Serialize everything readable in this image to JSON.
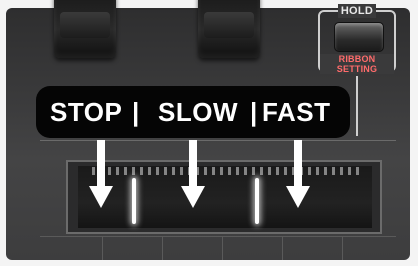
{
  "hold_panel": {
    "hold_label": "HOLD",
    "ribbon_setting_line1": "RIBBON",
    "ribbon_setting_line2": "SETTING"
  },
  "callout": {
    "stop": "STOP",
    "sep1": "|",
    "slow": "SLOW",
    "sep2": "|",
    "fast": "FAST"
  },
  "colors": {
    "ribbon_setting_text": "#ff6b6b",
    "callout_bg": "#050505",
    "led": "#ffffff"
  },
  "arrows": [
    {
      "zone": "STOP",
      "icon": "down-arrow-icon"
    },
    {
      "zone": "SLOW",
      "icon": "down-arrow-icon"
    },
    {
      "zone": "FAST",
      "icon": "down-arrow-icon"
    }
  ]
}
